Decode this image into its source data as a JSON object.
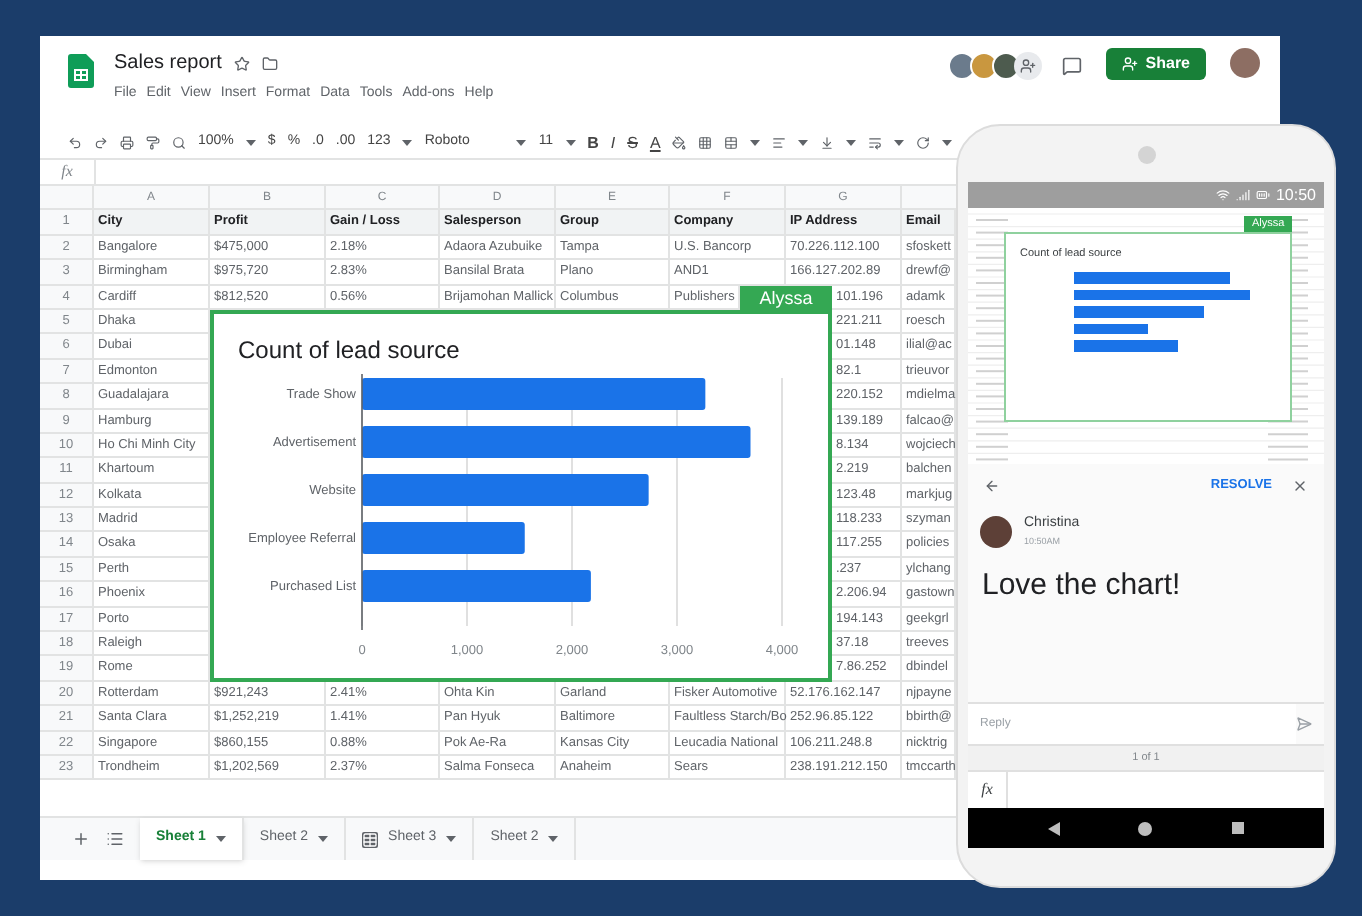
{
  "document": {
    "title": "Sales report"
  },
  "menu": [
    "File",
    "Edit",
    "View",
    "Insert",
    "Format",
    "Data",
    "Tools",
    "Add-ons",
    "Help"
  ],
  "share_button": {
    "label": "Share"
  },
  "toolbar": {
    "zoom": "100%",
    "currency": "$",
    "percent": "%",
    "decrease_decimals": ".0",
    "increase_decimals": ".00",
    "number_format": "123",
    "font": "Roboto",
    "font_size": "11",
    "bold": "B",
    "italic": "I",
    "strikethrough": "S",
    "text_color": "A"
  },
  "formula_bar": {
    "label": "fx"
  },
  "columns": [
    "A",
    "B",
    "C",
    "D",
    "E",
    "F",
    "G"
  ],
  "rows": [
    {
      "number": "1",
      "kind": "header",
      "cells": [
        "City",
        "Profit",
        "Gain / Loss",
        "Salesperson",
        "Group",
        "Company",
        "IP Address",
        "Email"
      ]
    },
    {
      "number": "2",
      "kind": "full",
      "cells": [
        "Bangalore",
        "$475,000",
        "2.18%",
        "Adaora Azubuike",
        "Tampa",
        "U.S. Bancorp",
        "70.226.112.100",
        "sfoskett"
      ]
    },
    {
      "number": "3",
      "kind": "full",
      "cells": [
        "Birmingham",
        "$975,720",
        "2.83%",
        "Bansilal Brata",
        "Plano",
        "AND1",
        "166.127.202.89",
        "drewf@"
      ]
    },
    {
      "number": "4",
      "kind": "tag",
      "cells": [
        "Cardiff",
        "$812,520",
        "0.56%",
        "Brijamohan Mallick",
        "Columbus",
        "Publishers",
        "101.196",
        "adamk"
      ]
    },
    {
      "number": "5",
      "kind": "under_chart",
      "cells": [
        "Dhaka",
        "221.211",
        "roesch"
      ]
    },
    {
      "number": "6",
      "kind": "under_chart",
      "cells": [
        "Dubai",
        "01.148",
        "ilial@ac"
      ]
    },
    {
      "number": "7",
      "kind": "under_chart",
      "cells": [
        "Edmonton",
        "82.1",
        "trieuvor"
      ]
    },
    {
      "number": "8",
      "kind": "under_chart",
      "cells": [
        "Guadalajara",
        "220.152",
        "mdielma"
      ]
    },
    {
      "number": "9",
      "kind": "under_chart",
      "cells": [
        "Hamburg",
        "139.189",
        "falcao@"
      ]
    },
    {
      "number": "10",
      "kind": "under_chart",
      "cells": [
        "Ho Chi Minh City",
        "8.134",
        "wojciech"
      ]
    },
    {
      "number": "11",
      "kind": "under_chart",
      "cells": [
        "Khartoum",
        "2.219",
        "balchen"
      ]
    },
    {
      "number": "12",
      "kind": "under_chart",
      "cells": [
        "Kolkata",
        "123.48",
        "markjug"
      ]
    },
    {
      "number": "13",
      "kind": "under_chart",
      "cells": [
        "Madrid",
        "118.233",
        "szyman"
      ]
    },
    {
      "number": "14",
      "kind": "under_chart",
      "cells": [
        "Osaka",
        "117.255",
        "policies"
      ]
    },
    {
      "number": "15",
      "kind": "under_chart",
      "cells": [
        "Perth",
        ".237",
        "ylchang"
      ]
    },
    {
      "number": "16",
      "kind": "under_chart",
      "cells": [
        "Phoenix",
        "2.206.94",
        "gastown"
      ]
    },
    {
      "number": "17",
      "kind": "under_chart",
      "cells": [
        "Porto",
        "194.143",
        "geekgrl"
      ]
    },
    {
      "number": "18",
      "kind": "under_chart",
      "cells": [
        "Raleigh",
        "37.18",
        "treeves"
      ]
    },
    {
      "number": "19",
      "kind": "under_chart",
      "cells": [
        "Rome",
        "7.86.252",
        "dbindel"
      ]
    },
    {
      "number": "20",
      "kind": "full",
      "cells": [
        "Rotterdam",
        "$921,243",
        "2.41%",
        "Ohta Kin",
        "Garland",
        "Fisker Automotive",
        "52.176.162.147",
        "njpayne"
      ]
    },
    {
      "number": "21",
      "kind": "full",
      "cells": [
        "Santa Clara",
        "$1,252,219",
        "1.41%",
        "Pan Hyuk",
        "Baltimore",
        "Faultless Starch/Bo",
        "252.96.85.122",
        "bbirth@"
      ]
    },
    {
      "number": "22",
      "kind": "full",
      "cells": [
        "Singapore",
        "$860,155",
        "0.88%",
        "Pok Ae-Ra",
        "Kansas City",
        "Leucadia National",
        "106.211.248.8",
        "nicktrig"
      ]
    },
    {
      "number": "23",
      "kind": "full",
      "cells": [
        "Trondheim",
        "$1,202,569",
        "2.37%",
        "Salma Fonseca",
        "Anaheim",
        "Sears",
        "238.191.212.150",
        "tmccarth"
      ]
    }
  ],
  "chart": {
    "tag": "Alyssa",
    "chart_data": {
      "type": "bar",
      "orientation": "horizontal",
      "title": "Count of lead source",
      "categories": [
        "Trade Show",
        "Advertisement",
        "Website",
        "Employee Referral",
        "Purchased List"
      ],
      "series": [
        {
          "color": "#1a73e8",
          "values": [
            3270,
            3700,
            2730,
            1550,
            2180
          ]
        }
      ],
      "grid": true,
      "xlim": [
        0,
        4000
      ],
      "xticks": [
        {
          "value": 0,
          "label": "0"
        },
        {
          "value": 1000,
          "label": "1,000"
        },
        {
          "value": 2000,
          "label": "2,000"
        },
        {
          "value": 3000,
          "label": "3,000"
        },
        {
          "value": 4000,
          "label": "4,000"
        }
      ]
    }
  },
  "sheet_tabs": [
    {
      "label": "Sheet 1",
      "selected": true,
      "kind": "plain"
    },
    {
      "label": "Sheet 2",
      "selected": false,
      "kind": "plain"
    },
    {
      "label": "Sheet 3",
      "selected": false,
      "kind": "linked"
    },
    {
      "label": "Sheet 2",
      "selected": false,
      "kind": "plain"
    }
  ],
  "phone": {
    "time": "10:50",
    "preview": {
      "tag": "Alyssa",
      "title": "Count of lead source"
    },
    "comment": {
      "action": "RESOLVE",
      "author": "Christina",
      "time": "10:50AM",
      "text": "Love the chart!",
      "reply_placeholder": "Reply",
      "pager": "1 of 1",
      "formula_label": "fx"
    }
  }
}
